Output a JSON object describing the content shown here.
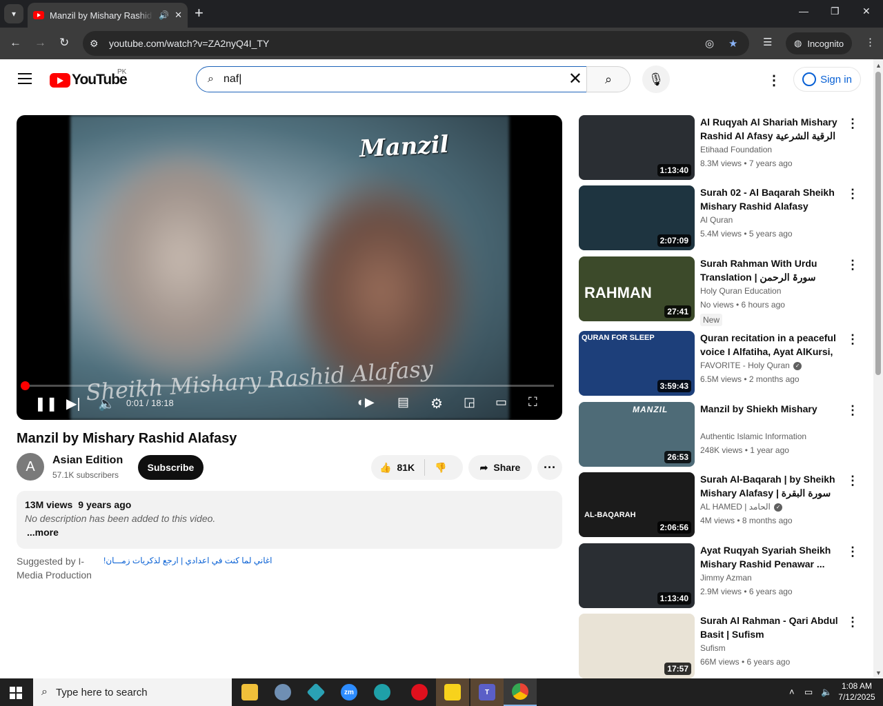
{
  "browser": {
    "tab_title": "Manzil by Mishary Rashid Alafasy",
    "url": "youtube.com/watch?v=ZA2nyQ4I_TY",
    "incognito_label": "Incognito"
  },
  "header": {
    "logo_text": "YouTube",
    "country_code": "PK",
    "search_value": "naf",
    "signin_label": "Sign in"
  },
  "player": {
    "video_title_overlay": "Manzil",
    "video_caption_overlay": "Sheikh Mishary Rashid Alafasy",
    "time": "0:01 / 18:18",
    "progress_fraction": 0.001
  },
  "video": {
    "title": "Manzil by Mishary Rashid Alafasy",
    "channel_initial": "A",
    "channel_name": "Asian Edition",
    "subscribers": "57.1K subscribers",
    "subscribe_label": "Subscribe",
    "likes": "81K",
    "share_label": "Share",
    "views": "13M views",
    "age": "9 years ago",
    "description": "No description has been added to this video.",
    "more_label": "...more",
    "suggested_by": "Suggested by I-Media Production",
    "suggested_link": "اغاني لما كنت في اعدادي | ارجع لذكريات زمـــان!"
  },
  "recommendations": [
    {
      "title": "Al Ruqyah Al Shariah Mishary Rashid Al Afasy الرقية الشرعية",
      "channel": "Etihaad Foundation",
      "meta": "8.3M views • 7 years ago",
      "duration": "1:13:40",
      "verified": false,
      "badge": "",
      "bg": "#2a2e33"
    },
    {
      "title": "Surah 02 - Al Baqarah Sheikh Mishary Rashid Alafasy",
      "channel": "Al Quran",
      "meta": "5.4M views • 5 years ago",
      "duration": "2:07:09",
      "verified": false,
      "badge": "",
      "bg": "#1e3440"
    },
    {
      "title": "Surah Rahman With Urdu Translation | سورۃ الرحمن ترجمہ کے ساتھ",
      "channel": "Holy Quran Education",
      "meta": "No views • 6 hours ago",
      "duration": "27:41",
      "verified": false,
      "badge": "New",
      "bg": "#3c4a2a",
      "overlay": "RAHMAN"
    },
    {
      "title": "Quran recitation in a peaceful voice I Alfatiha, Ayat AlKursi, ...",
      "channel": "FAVORITE - Holy Quran",
      "meta": "6.5M views • 2 months ago",
      "duration": "3:59:43",
      "verified": true,
      "badge": "",
      "bg": "#1d3f7a",
      "overlay": "QURAN FOR SLEEP"
    },
    {
      "title": "Manzil by Shiekh Mishary",
      "channel": "Authentic Islamic Information",
      "meta": "248K views • 1 year ago",
      "duration": "26:53",
      "verified": false,
      "badge": "",
      "bg": "#4e6b77",
      "overlay": "MANZIL"
    },
    {
      "title": "Surah Al-Baqarah | by Sheikh Mishary Alafasy سورة البقرة | بصوت",
      "channel": "AL HAMED | الحامد",
      "meta": "4M views • 8 months ago",
      "duration": "2:06:56",
      "verified": true,
      "badge": "",
      "bg": "#1b1b1b",
      "overlay": "AL-BAQARAH"
    },
    {
      "title": "Ayat Ruqyah Syariah Sheikh Mishary Rashid Penawar ...",
      "channel": "Jimmy Azman",
      "meta": "2.9M views • 6 years ago",
      "duration": "1:13:40",
      "verified": false,
      "badge": "",
      "bg": "#2a2e33"
    },
    {
      "title": "Surah Al Rahman - Qari Abdul Basit | Sufism",
      "channel": "Sufism",
      "meta": "66M views • 6 years ago",
      "duration": "17:57",
      "verified": false,
      "badge": "",
      "bg": "#e9e3d6"
    }
  ],
  "taskbar": {
    "search_placeholder": "Type here to search",
    "time": "1:08 AM",
    "date": "7/12/2025"
  }
}
